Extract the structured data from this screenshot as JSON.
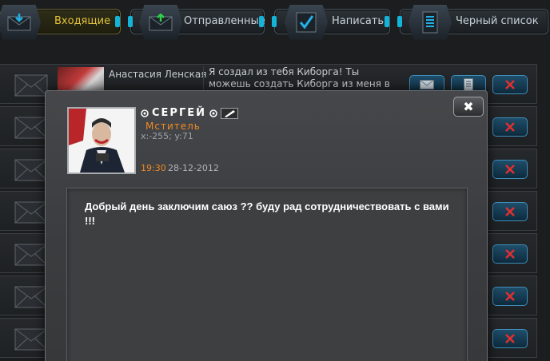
{
  "tabs": [
    {
      "label": "Входящие",
      "icon": "inbox-icon",
      "active": true
    },
    {
      "label": "Отправленные",
      "icon": "outbox-icon",
      "active": false
    },
    {
      "label": "Написать",
      "icon": "compose-icon",
      "active": false
    },
    {
      "label": "Черный список",
      "icon": "blacklist-icon",
      "active": false
    }
  ],
  "messages": [
    {
      "sender": "Анастасия Ленская",
      "preview": "Я создал из тебя Киборга! Ты можешь создать Киборга из меня в своей"
    }
  ],
  "modal": {
    "sender_name": "СЕРГЕЙ",
    "sender_title": "Мститель",
    "coords": "x:-255; y:71",
    "time": "19:30",
    "date": "28-12-2012",
    "body": "Добрый день заключим саюз ?? буду рад  сотрудничествовать  с вами !!!",
    "close_label": "✖"
  },
  "colors": {
    "accent_orange": "#f08a24",
    "accent_cyan": "#14b4d8",
    "active_tab_text": "#e3c23a",
    "delete_red": "#e03030"
  }
}
